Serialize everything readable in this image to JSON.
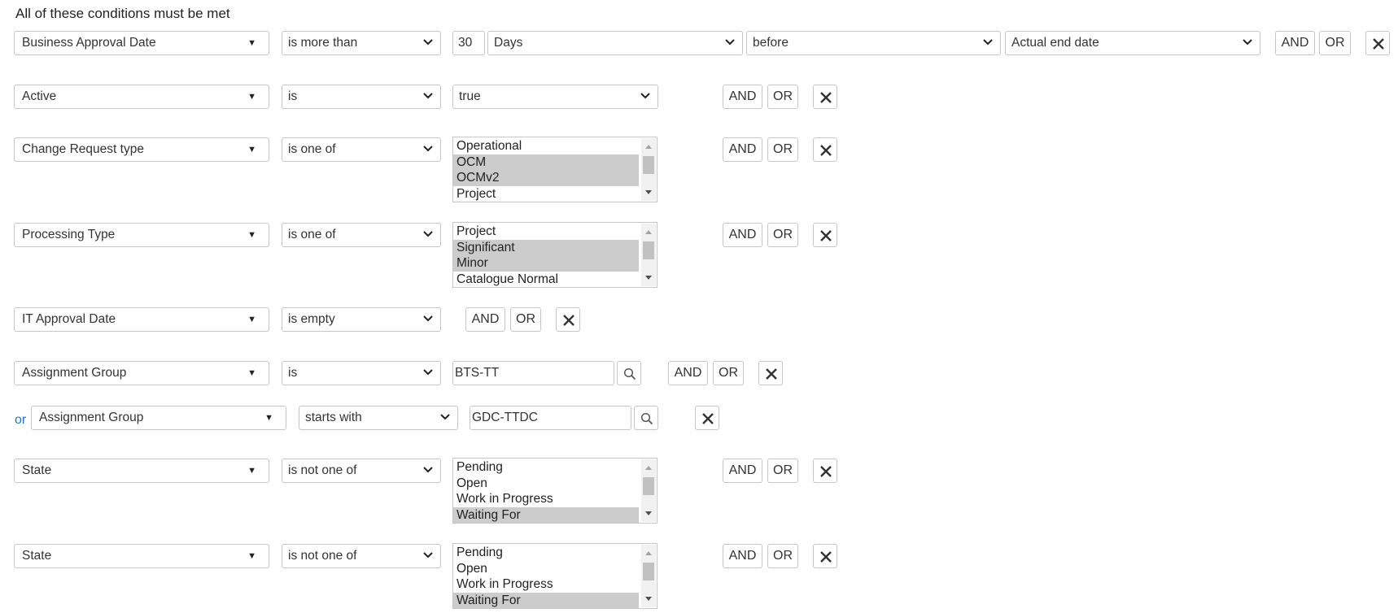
{
  "header": "All of these conditions must be met",
  "and_label": "AND",
  "or_label": "OR",
  "or_connector": "or",
  "row1": {
    "field": "Business Approval Date",
    "operator": "is more than",
    "number": "30",
    "unit": "Days",
    "relation": "before",
    "target": "Actual end date"
  },
  "row2": {
    "field": "Active",
    "operator": "is",
    "value": "true"
  },
  "row3": {
    "field": "Change Request type",
    "operator": "is one of",
    "options": [
      "Operational",
      "OCM",
      "OCMv2",
      "Project"
    ],
    "selected": [
      "OCM",
      "OCMv2"
    ]
  },
  "row4": {
    "field": "Processing Type",
    "operator": "is one of",
    "options": [
      "Project",
      "Significant",
      "Minor",
      "Catalogue Normal"
    ],
    "selected": [
      "Significant",
      "Minor"
    ]
  },
  "row5": {
    "field": "IT Approval Date",
    "operator": "is empty"
  },
  "row6": {
    "field": "Assignment Group",
    "operator": "is",
    "value": "BTS-TT"
  },
  "row7": {
    "field": "Assignment Group",
    "operator": "starts with",
    "value": "GDC-TTDC"
  },
  "row8": {
    "field": "State",
    "operator": "is not one of",
    "options": [
      "Pending",
      "Open",
      "Work in Progress",
      "Waiting For"
    ],
    "selected": [
      "Waiting For"
    ]
  },
  "row9": {
    "field": "State",
    "operator": "is not one of",
    "options": [
      "Pending",
      "Open",
      "Work in Progress",
      "Waiting For"
    ],
    "selected": [
      "Waiting For"
    ]
  }
}
